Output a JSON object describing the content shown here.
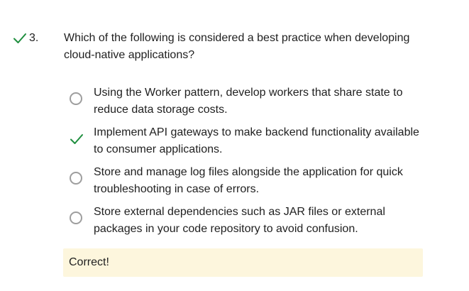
{
  "question": {
    "number": "3.",
    "status_icon": "check-icon",
    "status_color": "#1e8e3e",
    "text": "Which of the following is considered a best practice when developing cloud-native applications?",
    "options": [
      {
        "label": "Using the Worker pattern, develop workers that share state to reduce data storage costs.",
        "state": "unselected",
        "icon": "radio-circle"
      },
      {
        "label": "Implement API gateways to make backend functionality available to consumer applications.",
        "state": "correct",
        "icon": "check-icon"
      },
      {
        "label": "Store and manage log files alongside the application for quick troubleshooting in case of errors.",
        "state": "unselected",
        "icon": "radio-circle"
      },
      {
        "label": "Store external dependencies such as JAR files or external packages in your code repository to avoid confusion.",
        "state": "unselected",
        "icon": "radio-circle"
      }
    ],
    "feedback": {
      "text": "Correct!",
      "background": "#fdf6dd"
    }
  }
}
